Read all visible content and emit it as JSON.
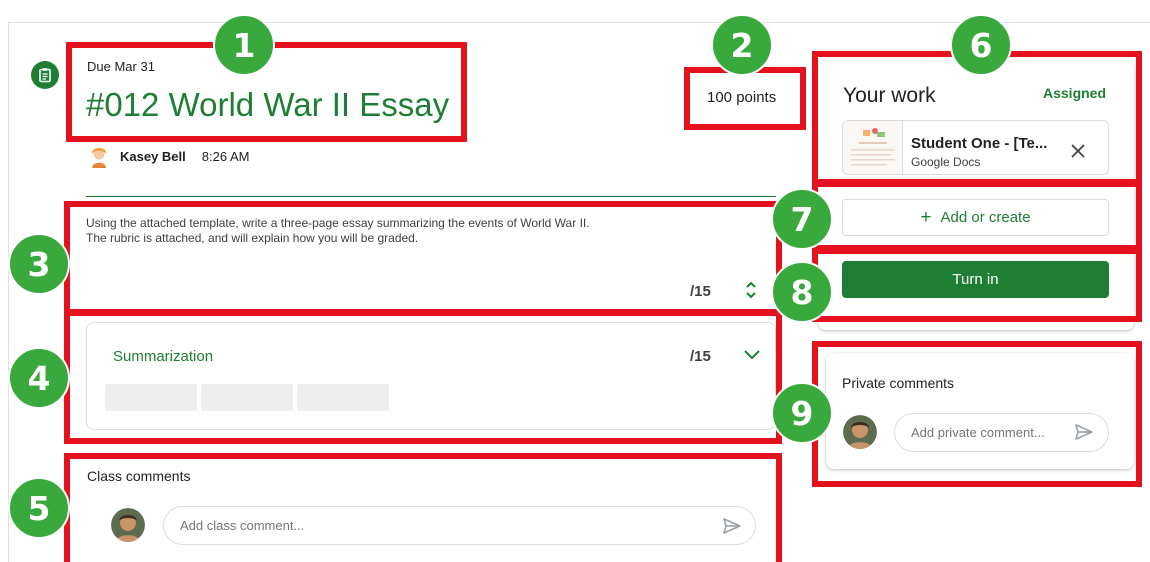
{
  "assignment": {
    "due": "Due Mar 31",
    "title": "#012 World War II Essay",
    "points": "100 points",
    "author": "Kasey Bell",
    "time": "8:26 AM",
    "instructions_line1": "Using the attached template, write a three-page essay summarizing the events of World War II.",
    "instructions_line2": "The rubric is attached, and will explain how you will be graded.",
    "score_total": "/15"
  },
  "rubric": {
    "criterion": "Summarization",
    "score": "/15"
  },
  "class_comments": {
    "heading": "Class comments",
    "placeholder": "Add class comment..."
  },
  "your_work": {
    "title": "Your work",
    "status": "Assigned",
    "attachment_name": "Student One - [Te...",
    "attachment_type": "Google Docs",
    "add_label": "Add or create",
    "turn_in_label": "Turn in"
  },
  "private_comments": {
    "heading": "Private comments",
    "placeholder": "Add private comment..."
  },
  "callouts": [
    "1",
    "2",
    "3",
    "4",
    "5",
    "6",
    "7",
    "8",
    "9"
  ],
  "colors": {
    "accent_green": "#1e7e34",
    "callout_green": "#39a83d",
    "highlight_red": "#e3121e"
  },
  "icons": [
    "assignment-icon",
    "author-avatar-icon",
    "expand-collapse-icon",
    "chevron-down-icon",
    "user-avatar-icon",
    "send-icon",
    "close-icon",
    "plus-icon",
    "doc-thumbnail-icon"
  ]
}
